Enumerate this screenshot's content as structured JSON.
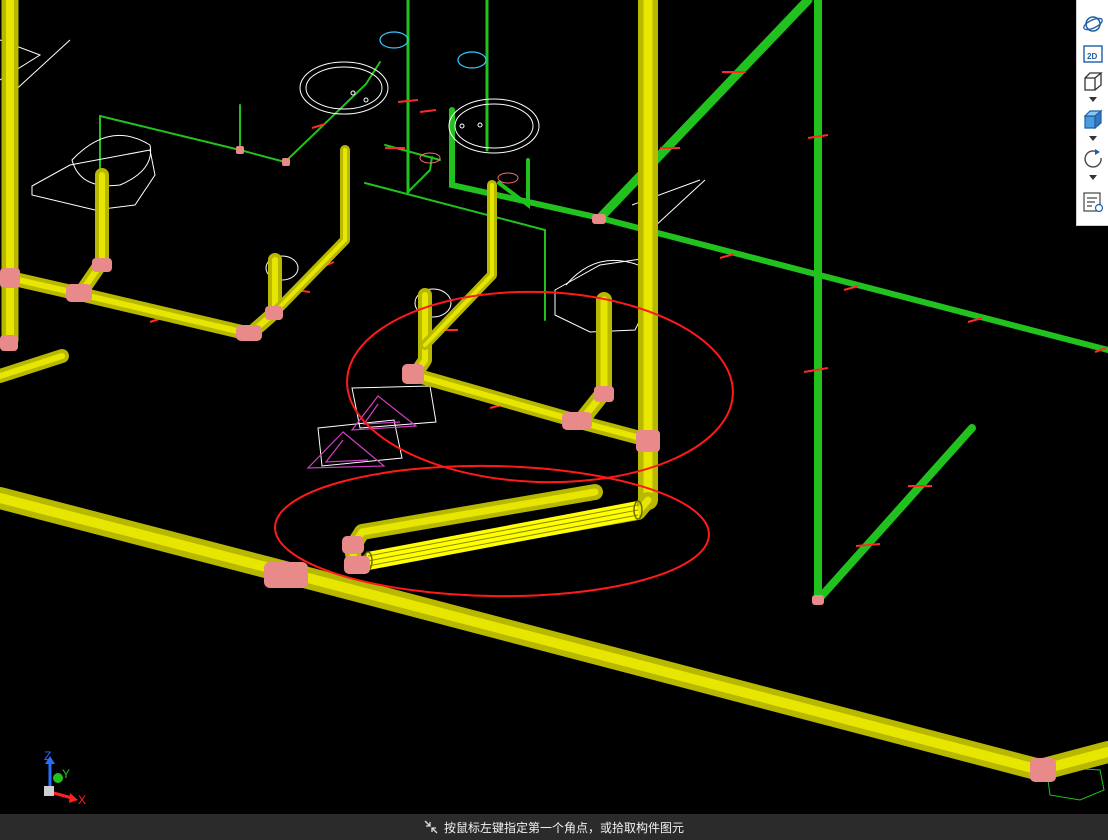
{
  "status_bar": {
    "prompt_text": "按鼠标左键指定第一个角点，或拾取构件图元",
    "icon": "select-corner-icon"
  },
  "axis_gizmo": {
    "z_label": "Z",
    "y_label": "Y",
    "x_label": "X"
  },
  "toolbar": {
    "items": [
      {
        "name": "orbit-view",
        "icon": "globe-orbit-icon"
      },
      {
        "name": "2d-view",
        "icon": "2d-icon",
        "label": "2D"
      },
      {
        "name": "3d-wireframe-view",
        "icon": "cube-outline-icon"
      },
      {
        "name": "3d-shaded-view",
        "icon": "cube-shaded-icon"
      },
      {
        "name": "rotate-view",
        "icon": "rotate-icon"
      },
      {
        "name": "properties-panel",
        "icon": "list-settings-icon"
      }
    ]
  },
  "colors": {
    "background": "#000000",
    "drain_pipe": "#d8d800",
    "supply_pipe": "#22c21e",
    "fitting": "#e88a8a",
    "highlight_ellipse": "#ff1a1a",
    "fixture_outline": "#ffffff",
    "floor_drain": "#d040c0",
    "toolbar_icon": "#1f5fa8"
  }
}
